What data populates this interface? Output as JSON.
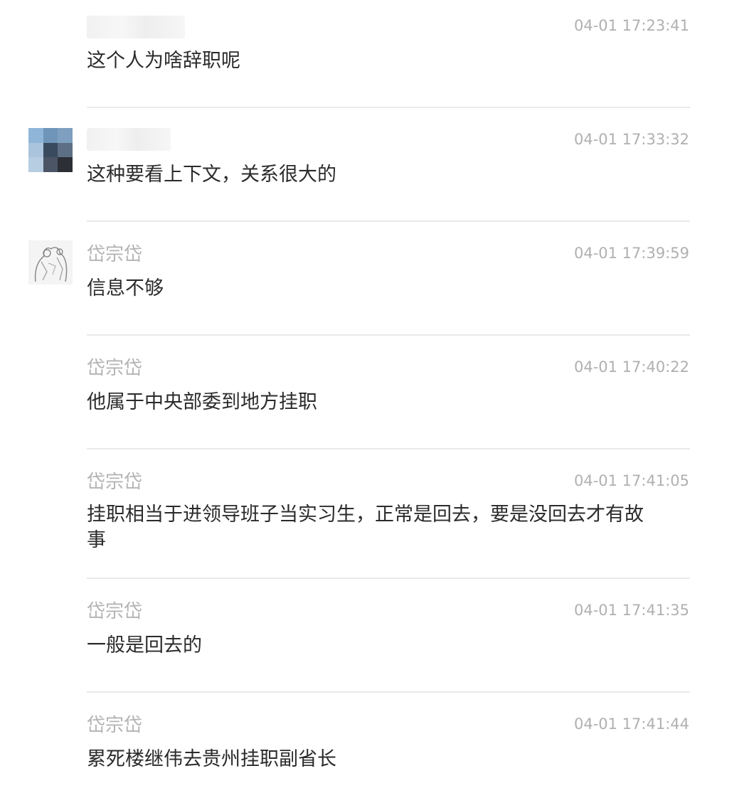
{
  "comments": [
    {
      "username": "",
      "username_masked": true,
      "time": "04-01 17:23:41",
      "content": "这个人为啥辞职呢",
      "avatar": "none"
    },
    {
      "username": "",
      "username_masked": true,
      "time": "04-01 17:33:32",
      "content": "这种要看上下文，关系很大的",
      "avatar": "pixelated-avatar-icon"
    },
    {
      "username": "岱宗岱",
      "time": "04-01 17:39:59",
      "content": "信息不够",
      "avatar": "sketch-figure-avatar-icon"
    },
    {
      "username": "岱宗岱",
      "time": "04-01 17:40:22",
      "content": "他属于中央部委到地方挂职",
      "avatar": "none"
    },
    {
      "username": "岱宗岱",
      "time": "04-01 17:41:05",
      "content": "挂职相当于进领导班子当实习生，正常是回去，要是没回去才有故事",
      "avatar": "none"
    },
    {
      "username": "岱宗岱",
      "time": "04-01 17:41:35",
      "content": "一般是回去的",
      "avatar": "none"
    },
    {
      "username": "岱宗岱",
      "time": "04-01 17:41:44",
      "content": "累死楼继伟去贵州挂职副省长",
      "avatar": "none"
    }
  ],
  "colors": {
    "username": "#b4b4b4",
    "timestamp": "#b0b0b0",
    "content": "#2b2b2b",
    "divider": "#e9e9e9"
  }
}
